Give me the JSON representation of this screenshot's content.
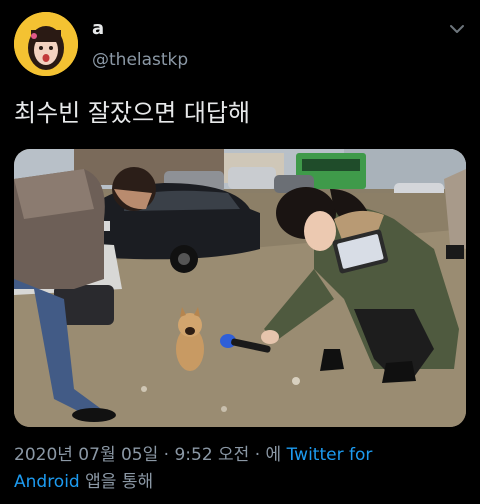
{
  "tweet": {
    "display_name": "a",
    "handle": "@thelastkp",
    "text": "최수빈 잘잤으면 대답해",
    "timestamp": "2020년 07월 05일 · 9:52 오전 · 에",
    "source_link_1": "Twitter for",
    "source_link_2": "Android",
    "source_suffix": "앱을 통해"
  },
  "icons": {
    "avatar": "avatar-portrait",
    "menu": "chevron-down-icon"
  },
  "colors": {
    "background": "#000000",
    "text": "#e7e9ea",
    "secondary": "#8b98a5",
    "link": "#1d9bf0"
  }
}
